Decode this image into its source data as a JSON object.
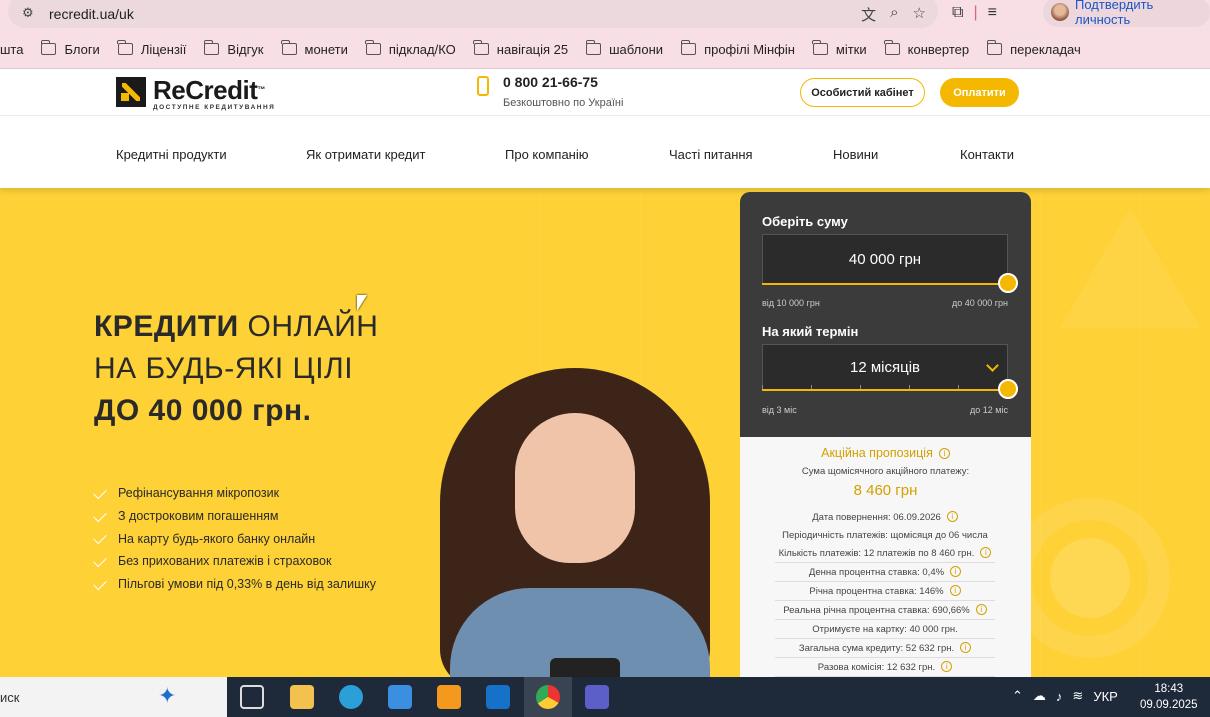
{
  "browser": {
    "url": "recredit.ua/uk",
    "profile_label": "Подтвердить личность",
    "bookmarks": [
      "шта",
      "Блоги",
      "Ліцензії",
      "Відгук",
      "монети",
      "підклад/КО",
      "навігація 25",
      "шаблони",
      "профілі Мінфін",
      "мітки",
      "конвертер",
      "перекладач"
    ]
  },
  "header": {
    "logo_name": "ReCredit",
    "logo_tm": "™",
    "logo_sub": "ДОСТУПНЕ КРЕДИТУВАННЯ",
    "phone": "0 800 21-66-75",
    "phone_sub": "Безкоштовно по Україні",
    "cabinet_label": "Особистий кабінет",
    "pay_label": "Оплатити"
  },
  "nav": {
    "items": [
      "Кредитні продукти",
      "Як отримати кредит",
      "Про компанію",
      "Часті питання",
      "Новини",
      "Контакти"
    ]
  },
  "hero": {
    "line1_bold": "КРЕДИТИ",
    "line1_rest": " ОНЛАЙН",
    "line2": "НА БУДЬ-ЯКІ ЦІЛІ",
    "line3": "ДО 40 000 грн.",
    "features": [
      "Рефінансування мікропозик",
      "З достроковим погашенням",
      "На карту будь-якого банку онлайн",
      "Без прихованих платежів і страховок",
      "Пільгові умови під 0,33% в день від залишку"
    ]
  },
  "calculator": {
    "amount_label": "Оберіть суму",
    "amount_value": "40 000 грн",
    "amount_min": "від 10 000 грн",
    "amount_max": "до 40 000 грн",
    "amount_level": 1.0,
    "term_label": "На який термін",
    "term_value": "12 місяців",
    "term_min": "від 3 міс",
    "term_max": "до 12 міс",
    "term_level": 1.0,
    "promo_title": "Акційна пропозиція",
    "promo_sub": "Сума щомісячного акційного платежу:",
    "promo_amount": "8 460 грн",
    "details": [
      "Дата повернення: 06.09.2026",
      "Періодичність платежів:  щомісяця до 06 числа",
      "Кількість платежів: 12 платежів  по  8 460  грн.",
      "Денна процентна ставка: 0,4%",
      "Річна процентна ставка: 146%",
      "Реальна річна процентна ставка: 690,66%",
      "Отримуєте на картку: 40 000  грн.",
      "Загальна сума кредиту: 52 632  грн.",
      "Разова комісія: 12 632  грн."
    ]
  },
  "taskbar": {
    "search_text": "иск",
    "lang": "УКР",
    "time": "18:43",
    "date": "09.09.2025"
  },
  "colors": {
    "brand_yellow": "#f5b800",
    "hero_bg": "#fed136",
    "calc_dark": "#3b3b3b"
  }
}
